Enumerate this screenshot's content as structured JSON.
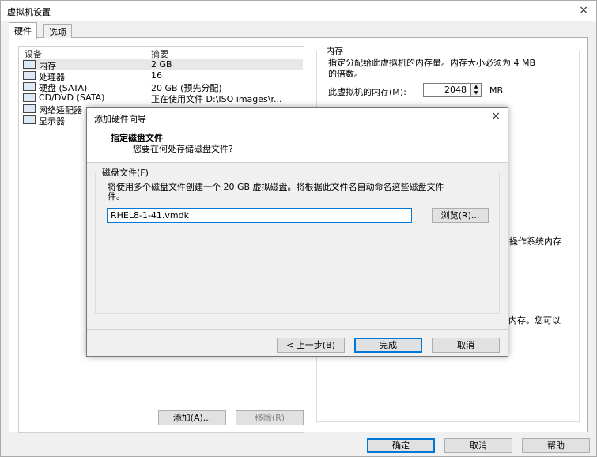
{
  "window": {
    "title": "虚拟机设置",
    "close_icon": "×"
  },
  "tabs": [
    {
      "label": "硬件"
    },
    {
      "label": "选项"
    }
  ],
  "device_list": {
    "headers": {
      "device": "设备",
      "summary": "摘要"
    },
    "rows": [
      {
        "name": "内存",
        "summary": "2 GB",
        "icon": "memory-icon"
      },
      {
        "name": "处理器",
        "summary": "16",
        "icon": "cpu-icon"
      },
      {
        "name": "硬盘 (SATA)",
        "summary": "20 GB (预先分配)",
        "icon": "hard-disk-icon"
      },
      {
        "name": "CD/DVD (SATA)",
        "summary": "正在使用文件 D:\\ISO images\\r...",
        "icon": "cd-dvd-icon"
      },
      {
        "name": "网络适配器",
        "summary": "",
        "icon": "network-adapter-icon"
      },
      {
        "name": "显示器",
        "summary": "",
        "icon": "display-icon"
      }
    ],
    "add_button": "添加(A)...",
    "remove_button": "移除(R)"
  },
  "memory_panel": {
    "group_title": "内存",
    "desc_line1": "指定分配给此虚拟机的内存量。内存大小必须为 4 MB",
    "desc_line2": "的倍数。",
    "label": "此虚拟机的内存(M):",
    "value": "2048",
    "unit": "MB",
    "os_text": "操作系统内存",
    "tip_text": "多内存。您可以"
  },
  "footer": {
    "ok": "确定",
    "cancel": "取消",
    "help": "帮助"
  },
  "wizard": {
    "title": "添加硬件向导",
    "close_icon": "×",
    "heading": "指定磁盘文件",
    "subheading": "您要在何处存储磁盘文件?",
    "group_title": "磁盘文件(F)",
    "desc_line1": "将使用多个磁盘文件创建一个 20 GB 虚拟磁盘。将根据此文件名自动命名这些磁盘文件",
    "desc_line2": "件。",
    "file_value": "RHEL8-1-41.vmdk",
    "browse": "浏览(R)...",
    "back": "< 上一步(B)",
    "finish": "完成",
    "cancel": "取消"
  }
}
